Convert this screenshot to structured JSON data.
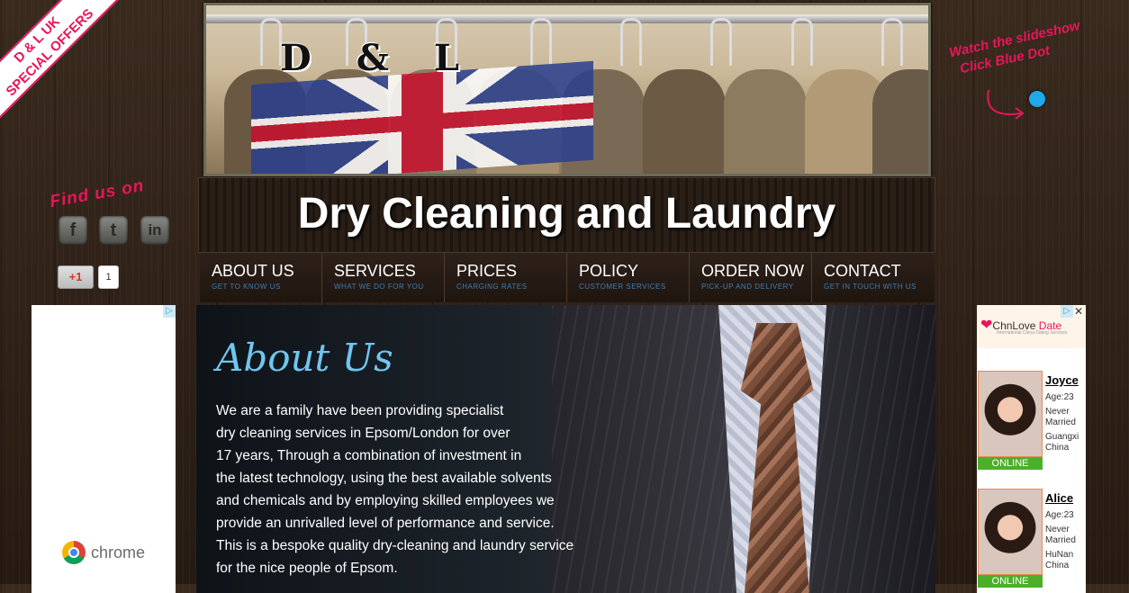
{
  "ribbon": {
    "line1": "D & L UK",
    "line2": "SPECIAL OFFERS"
  },
  "banner": {
    "logo": [
      "D",
      "&",
      "L"
    ]
  },
  "site_title": "Dry Cleaning and Laundry",
  "nav": [
    {
      "label": "ABOUT US",
      "sub": "GET TO KNOW US"
    },
    {
      "label": "SERVICES",
      "sub": "WHAT WE DO FOR YOU"
    },
    {
      "label": "PRICES",
      "sub": "CHARGING RATES"
    },
    {
      "label": "POLICY",
      "sub": "CUSTOMER SERVICES"
    },
    {
      "label": "ORDER NOW",
      "sub": "PICK-UP AND DELIVERY"
    },
    {
      "label": "CONTACT",
      "sub": "GET IN TOUCH WITH US"
    }
  ],
  "about": {
    "title": "About Us",
    "lines": [
      "We are a family have been providing specialist",
      "dry cleaning services in Epsom/London for over",
      "17 years, Through a combination of investment in",
      "the latest technology, using the best available solvents",
      "and chemicals and by employing skilled employees we",
      "provide an unrivalled level of performance and service.",
      "This is a bespoke quality dry-cleaning and laundry service",
      "for the nice people of Epsom."
    ]
  },
  "social": {
    "heading": "Find us on",
    "icons": [
      {
        "name": "facebook-icon",
        "glyph": "f"
      },
      {
        "name": "twitter-icon",
        "glyph": "t"
      },
      {
        "name": "linkedin-icon",
        "glyph": "in"
      }
    ],
    "gplus_label": "+1",
    "gplus_count": "1"
  },
  "slideshow_note": {
    "line1": "Watch the slideshow",
    "line2": "Click Blue Dot"
  },
  "left_ad": {
    "brand": "chrome",
    "adchoice": "▷"
  },
  "right_ad": {
    "brand": "ChnLove",
    "brand_suffix": "Date",
    "tagline": "International China Dating Services",
    "close": "✕",
    "profiles": [
      {
        "name": "Joyce",
        "age": "Age:23",
        "status": "Never Married",
        "location": "Guangxi China",
        "online": "ONLINE"
      },
      {
        "name": "Alice",
        "age": "Age:23",
        "status": "Never Married",
        "location": "HuNan China",
        "online": "ONLINE"
      }
    ]
  }
}
